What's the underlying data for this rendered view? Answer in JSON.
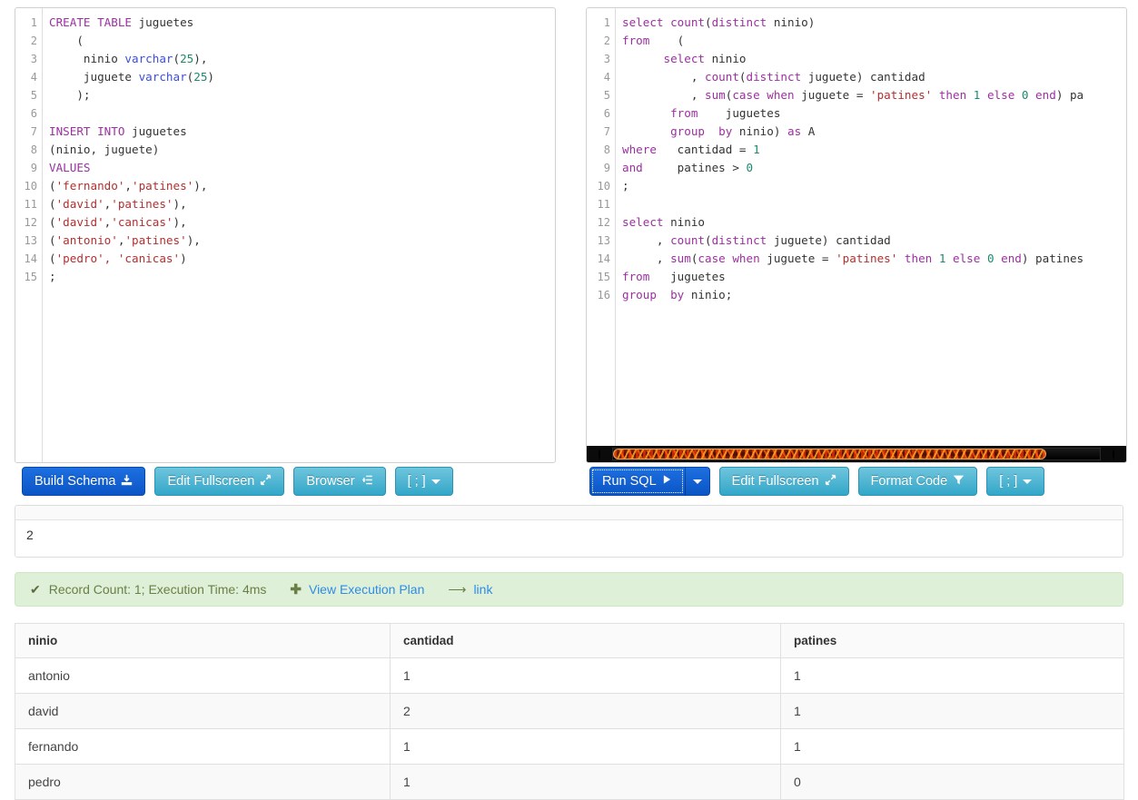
{
  "schema_editor": {
    "name": "schema-sql-editor",
    "lines": [
      [
        {
          "t": "CREATE TABLE ",
          "c": "kw"
        },
        {
          "t": "juguetes",
          "c": "pl"
        }
      ],
      [
        {
          "t": "    (",
          "c": "pl"
        }
      ],
      [
        {
          "t": "     ninio ",
          "c": "pl"
        },
        {
          "t": "varchar",
          "c": "typ"
        },
        {
          "t": "(",
          "c": "pl"
        },
        {
          "t": "25",
          "c": "num"
        },
        {
          "t": "),",
          "c": "pl"
        }
      ],
      [
        {
          "t": "     juguete ",
          "c": "pl"
        },
        {
          "t": "varchar",
          "c": "typ"
        },
        {
          "t": "(",
          "c": "pl"
        },
        {
          "t": "25",
          "c": "num"
        },
        {
          "t": ")",
          "c": "pl"
        }
      ],
      [
        {
          "t": "    );",
          "c": "pl"
        }
      ],
      [
        {
          "t": "",
          "c": "pl"
        }
      ],
      [
        {
          "t": "INSERT INTO ",
          "c": "kw"
        },
        {
          "t": "juguetes",
          "c": "pl"
        }
      ],
      [
        {
          "t": "(ninio, juguete)",
          "c": "pl"
        }
      ],
      [
        {
          "t": "VALUES",
          "c": "kw"
        }
      ],
      [
        {
          "t": "(",
          "c": "pl"
        },
        {
          "t": "'fernando'",
          "c": "str"
        },
        {
          "t": ",",
          "c": "pl"
        },
        {
          "t": "'patines'",
          "c": "str"
        },
        {
          "t": "),",
          "c": "pl"
        }
      ],
      [
        {
          "t": "(",
          "c": "pl"
        },
        {
          "t": "'david'",
          "c": "str"
        },
        {
          "t": ",",
          "c": "pl"
        },
        {
          "t": "'patines'",
          "c": "str"
        },
        {
          "t": "),",
          "c": "pl"
        }
      ],
      [
        {
          "t": "(",
          "c": "pl"
        },
        {
          "t": "'david'",
          "c": "str"
        },
        {
          "t": ",",
          "c": "pl"
        },
        {
          "t": "'canicas'",
          "c": "str"
        },
        {
          "t": "),",
          "c": "pl"
        }
      ],
      [
        {
          "t": "(",
          "c": "pl"
        },
        {
          "t": "'antonio'",
          "c": "str"
        },
        {
          "t": ",",
          "c": "pl"
        },
        {
          "t": "'patines'",
          "c": "str"
        },
        {
          "t": "),",
          "c": "pl"
        }
      ],
      [
        {
          "t": "(",
          "c": "pl"
        },
        {
          "t": "'pedro', ",
          "c": "str"
        },
        {
          "t": "'canicas'",
          "c": "str"
        },
        {
          "t": ")",
          "c": "pl"
        }
      ],
      [
        {
          "t": ";",
          "c": "pl"
        }
      ]
    ],
    "plain_text": "CREATE TABLE juguetes\n    (\n     ninio varchar(25),\n     juguete varchar(25)\n    );\n\nINSERT INTO juguetes\n(ninio, juguete)\nVALUES\n('fernando','patines'),\n('david','patines'),\n('david','canicas'),\n('antonio','patines'),\n('pedro', 'canicas')\n;"
  },
  "query_editor": {
    "name": "query-sql-editor",
    "lines": [
      [
        {
          "t": "select ",
          "c": "kw"
        },
        {
          "t": "count",
          "c": "kw"
        },
        {
          "t": "(",
          "c": "pl"
        },
        {
          "t": "distinct",
          "c": "kw"
        },
        {
          "t": " ninio)",
          "c": "pl"
        }
      ],
      [
        {
          "t": "from",
          "c": "kw"
        },
        {
          "t": "    (",
          "c": "pl"
        }
      ],
      [
        {
          "t": "      ",
          "c": "pl"
        },
        {
          "t": "select",
          "c": "kw"
        },
        {
          "t": " ninio",
          "c": "pl"
        }
      ],
      [
        {
          "t": "          , ",
          "c": "pl"
        },
        {
          "t": "count",
          "c": "kw"
        },
        {
          "t": "(",
          "c": "pl"
        },
        {
          "t": "distinct",
          "c": "kw"
        },
        {
          "t": " juguete) cantidad",
          "c": "pl"
        }
      ],
      [
        {
          "t": "          , ",
          "c": "pl"
        },
        {
          "t": "sum",
          "c": "kw"
        },
        {
          "t": "(",
          "c": "pl"
        },
        {
          "t": "case when",
          "c": "kw"
        },
        {
          "t": " juguete = ",
          "c": "pl"
        },
        {
          "t": "'patines'",
          "c": "str"
        },
        {
          "t": " then",
          "c": "kw"
        },
        {
          "t": " ",
          "c": "pl"
        },
        {
          "t": "1",
          "c": "num"
        },
        {
          "t": " else",
          "c": "kw"
        },
        {
          "t": " ",
          "c": "pl"
        },
        {
          "t": "0",
          "c": "num"
        },
        {
          "t": " end",
          "c": "kw"
        },
        {
          "t": ") pa",
          "c": "pl"
        }
      ],
      [
        {
          "t": "       ",
          "c": "pl"
        },
        {
          "t": "from",
          "c": "kw"
        },
        {
          "t": "    juguetes",
          "c": "pl"
        }
      ],
      [
        {
          "t": "       ",
          "c": "pl"
        },
        {
          "t": "group  by",
          "c": "kw"
        },
        {
          "t": " ninio) ",
          "c": "pl"
        },
        {
          "t": "as",
          "c": "kw"
        },
        {
          "t": " A",
          "c": "pl"
        }
      ],
      [
        {
          "t": "where",
          "c": "kw"
        },
        {
          "t": "   cantidad = ",
          "c": "pl"
        },
        {
          "t": "1",
          "c": "num"
        }
      ],
      [
        {
          "t": "and",
          "c": "kw"
        },
        {
          "t": "     patines > ",
          "c": "pl"
        },
        {
          "t": "0",
          "c": "num"
        }
      ],
      [
        {
          "t": ";",
          "c": "pl"
        }
      ],
      [
        {
          "t": "",
          "c": "pl"
        }
      ],
      [
        {
          "t": "select",
          "c": "kw"
        },
        {
          "t": " ninio",
          "c": "pl"
        }
      ],
      [
        {
          "t": "     , ",
          "c": "pl"
        },
        {
          "t": "count",
          "c": "kw"
        },
        {
          "t": "(",
          "c": "pl"
        },
        {
          "t": "distinct",
          "c": "kw"
        },
        {
          "t": " juguete) cantidad",
          "c": "pl"
        }
      ],
      [
        {
          "t": "     , ",
          "c": "pl"
        },
        {
          "t": "sum",
          "c": "kw"
        },
        {
          "t": "(",
          "c": "pl"
        },
        {
          "t": "case when",
          "c": "kw"
        },
        {
          "t": " juguete = ",
          "c": "pl"
        },
        {
          "t": "'patines'",
          "c": "str"
        },
        {
          "t": " then",
          "c": "kw"
        },
        {
          "t": " ",
          "c": "pl"
        },
        {
          "t": "1",
          "c": "num"
        },
        {
          "t": " else",
          "c": "kw"
        },
        {
          "t": " ",
          "c": "pl"
        },
        {
          "t": "0",
          "c": "num"
        },
        {
          "t": " end",
          "c": "kw"
        },
        {
          "t": ") patines",
          "c": "pl"
        }
      ],
      [
        {
          "t": "from",
          "c": "kw"
        },
        {
          "t": "   juguetes",
          "c": "pl"
        }
      ],
      [
        {
          "t": "group",
          "c": "kw"
        },
        {
          "t": "  ",
          "c": "pl"
        },
        {
          "t": "by",
          "c": "kw"
        },
        {
          "t": " ninio;",
          "c": "pl"
        }
      ]
    ],
    "plain_text": "select count(distinct ninio)\nfrom    (\n      select ninio\n          , count(distinct juguete) cantidad\n          , sum(case when juguete = 'patines' then 1 else 0 end) patines\n       from    juguetes\n       group  by ninio) as A\nwhere   cantidad = 1\nand     patines > 0\n;\n\nselect ninio\n     , count(distinct juguete) cantidad\n     , sum(case when juguete = 'patines' then 1 else 0 end) patines\nfrom   juguetes\ngroup  by ninio;"
  },
  "schema_toolbar": {
    "build_schema_label": "Build Schema",
    "build_schema_icon": "download-icon",
    "edit_fullscreen_label": "Edit Fullscreen",
    "edit_fullscreen_icon": "expand-arrows-icon",
    "browser_label": "Browser",
    "browser_icon": "list-indent-icon",
    "terminator_label": "[ ; ]"
  },
  "query_toolbar": {
    "run_sql_label": "Run SQL",
    "run_sql_icon": "play-icon",
    "edit_fullscreen_label": "Edit Fullscreen",
    "edit_fullscreen_icon": "expand-arrows-icon",
    "format_code_label": "Format Code",
    "format_code_icon": "funnel-icon",
    "terminator_label": "[ ; ]"
  },
  "scalar_result": {
    "value": "2"
  },
  "status_bar": {
    "check_icon": "checkmark-icon",
    "message": "Record Count: 1; Execution Time: 4ms",
    "plus_icon": "plus-icon",
    "execution_plan_label": "View Execution Plan",
    "share_icon": "share-arrow-icon",
    "link_label": "link",
    "background_color": "#dff0d8",
    "text_color": "#6a7f45",
    "link_color": "#2f8be6"
  },
  "results_table": {
    "columns": [
      "ninio",
      "cantidad",
      "patines"
    ],
    "rows": [
      [
        "antonio",
        "1",
        "1"
      ],
      [
        "david",
        "2",
        "1"
      ],
      [
        "fernando",
        "1",
        "1"
      ],
      [
        "pedro",
        "1",
        "0"
      ]
    ]
  },
  "theme": {
    "primary_button": "#0b55c6",
    "teal_button": "#33a7c8",
    "keyword_color": "#9b30a0",
    "type_color": "#3b4fd8",
    "string_color": "#b03030",
    "number_color": "#1a8a6d"
  }
}
